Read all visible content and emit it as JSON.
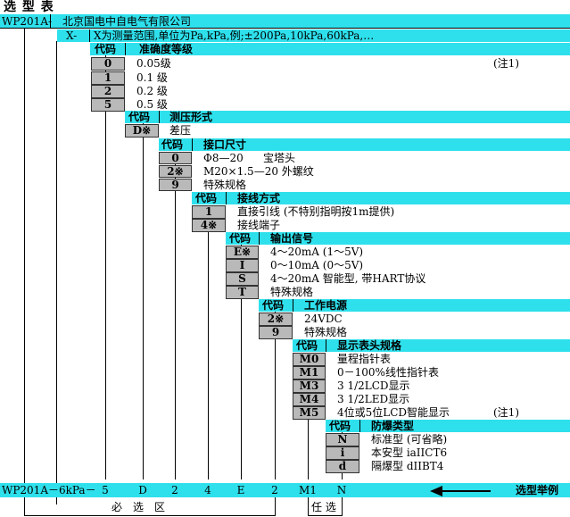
{
  "title": "选 型 表",
  "model": {
    "code": "WP201A-",
    "manufacturer": "北京国电中自电气有限公司",
    "x_code": "X-",
    "x_desc": "X为测量范围,单位为Pa,kPa,例;±200Pa,10kPa,60kPa,…"
  },
  "common": {
    "code_label": "代码"
  },
  "groups": {
    "accuracy": {
      "title": "准确度等级",
      "items": [
        {
          "code": "0",
          "desc": "0.05级",
          "note": "(注1)"
        },
        {
          "code": "1",
          "desc": "0.1 级"
        },
        {
          "code": "2",
          "desc": "0.2 级"
        },
        {
          "code": "5",
          "desc": "0.5 级"
        }
      ]
    },
    "measure": {
      "title": "测压形式",
      "items": [
        {
          "code": "D※",
          "desc": "差压"
        }
      ]
    },
    "interface": {
      "title": "接口尺寸",
      "items": [
        {
          "code": "0",
          "desc": "Φ8—20",
          "desc2": "宝塔头"
        },
        {
          "code": "2※",
          "desc": "M20×1.5—20 外螺纹"
        },
        {
          "code": "9",
          "desc": "特殊规格"
        }
      ]
    },
    "wiring": {
      "title": "接线方式",
      "items": [
        {
          "code": "1",
          "desc": "直接引线 (不特别指明按1m提供)"
        },
        {
          "code": "4※",
          "desc": "接线端子"
        }
      ]
    },
    "output": {
      "title": "输出信号",
      "items": [
        {
          "code": "E※",
          "desc": "4～20mA  (1～5V)"
        },
        {
          "code": "I",
          "desc": "0～10mA  (0～5V)"
        },
        {
          "code": "S",
          "desc": "4～20mA  智能型, 带HART协议"
        },
        {
          "code": "T",
          "desc": "特殊规格"
        }
      ]
    },
    "power": {
      "title": "工作电源",
      "items": [
        {
          "code": "2※",
          "desc": "24VDC"
        },
        {
          "code": "9",
          "desc": "特殊规格"
        }
      ]
    },
    "display": {
      "title": "显示表头规格",
      "items": [
        {
          "code": "M0",
          "desc": "量程指针表"
        },
        {
          "code": "M1",
          "desc": "0－100%线性指针表"
        },
        {
          "code": "M3",
          "desc": "3 1/2LCD显示"
        },
        {
          "code": "M4",
          "desc": "3 1/2LED显示"
        },
        {
          "code": "M5",
          "desc": "4位或5位LCD智能显示",
          "note": "(注1)"
        }
      ]
    },
    "explosion": {
      "title": "防爆类型",
      "items": [
        {
          "code": "N",
          "desc": "标准型 (可省略)"
        },
        {
          "code": "i",
          "desc": "本安型  iaIICT6"
        },
        {
          "code": "d",
          "desc": "隔爆型  dIIBT4"
        }
      ]
    }
  },
  "example": {
    "label": "选型举例",
    "codes": [
      "WP201A－6kPa－",
      "5",
      "D",
      "2",
      "4",
      "E",
      "2",
      "M1",
      "N"
    ]
  },
  "footer": {
    "required": "必　选　区",
    "optional": "任 选"
  }
}
